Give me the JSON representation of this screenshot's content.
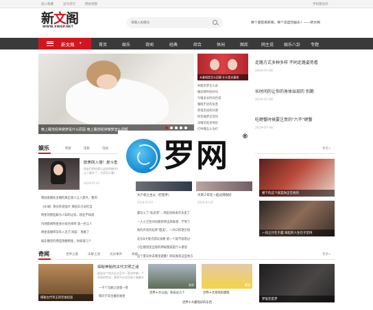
{
  "topbar": {
    "links": [
      "加入收藏",
      "设为首页",
      "网站地图"
    ],
    "right": "手机版访问"
  },
  "logo": {
    "main_a": "新",
    "main_b": "文",
    "main_c": "阁",
    "domain": "WWW.XWGP.NET"
  },
  "search": {
    "placeholder": "请输入关键词"
  },
  "slogan": "换个姿势看新闻，换个态度玩娱乐！——新文阁",
  "nav": {
    "home_label": "新文阁",
    "items": [
      "首页",
      "娱乐",
      "奇闻",
      "经典",
      "综合",
      "休闲",
      "图库",
      "网主说",
      "娱乐八卦",
      "专题"
    ]
  },
  "hero": {
    "caption": "晚上睡觉经常做梦是什么原因 晚上睡觉经常做梦怎么调理"
  },
  "side": {
    "photo_caption": "夫妻相是怎么回事 什么是夫妻相",
    "list": [
      "失眠多梦怎么办",
      "睡前喝牛奶好吗",
      "午睡多长时间合适",
      "睡眠不足的危害",
      "熬夜后如何补救",
      "经常做梦正常吗",
      "早睡早起身体好",
      "打呼噜怎么治疗"
    ]
  },
  "right_news": [
    {
      "title": "走路方式多种多样 不同走路姿势看",
      "date": "2019-07-06"
    },
    {
      "title": "长时间的让你的身体出现的 别跪",
      "date": "2019-07-06"
    },
    {
      "title": "吃螃蟹时候要注意的\"六不\"螃蟹",
      "date": "2019-07-06"
    }
  ],
  "ent": {
    "title": "娱乐",
    "tabs": [
      "明星",
      "电影",
      "电视"
    ],
    "more": "更多+",
    "head": "欧美网入侵！是斗鱼",
    "desc": "网友们纷纷表示这样的操作实在是太让人意外了，大家怎么看？",
    "date": "2019-07-07",
    "list": [
      "韩国直播女主播的真正收入让人意外，看到",
      "《长城》演员阵容强大 演技实力派担当",
      "明星的那些鲜为人知的过去，粉丝不知道",
      "内地影视明星身价排名榜单 第一名让人",
      "明星直播带货年入百万 网友：羡慕了",
      "娱乐圈里的那些隐婚明星，你知道几个"
    ]
  },
  "mid": {
    "cap1": "大户权之主以（打招手）",
    "date1": "2019-07-07",
    "cap2": "大英少年在一起过得很好",
    "date2": "2019-07-07",
    "list": [
      "最近火了\"仙女装\"，网友纷纷表示太美了",
      "一人小卫生间也能装修出高级感，学到了",
      "他的声音听起来\"甜美\"，一开口惊艳全场",
      "北京8大景点游玩攻略 第一个就不容错过",
      "小区楼道里出现的神秘图案是什么意思",
      "这个夏天你去哪里避暑？网友推荐这些地方"
    ]
  },
  "rimgs": [
    {
      "cap": "楼下的这个就是你正在找的"
    },
    {
      "cap": "一日之计在于晨 早起的人生在于坚持"
    }
  ],
  "watermark": {
    "text": "罗网",
    "reg": "®"
  },
  "strange": {
    "title": "奇闻",
    "tabs": [
      "世界之最",
      "未解之谜",
      "灵异事件",
      "奇趣"
    ],
    "more": "更多+",
    "thumb_caption": "揭秘古代帝王的饮食起居",
    "head": "探秘神秘的古代文明之谜",
    "desc": "据说这个地方从古至今一直流传着一个奇怪的传说，直到今天也没有人能解开",
    "list": [
      "一千个无解之谜第一卷",
      "揭开千年古墓的秘密"
    ],
    "captions": [
      "世界十大公园，你去过几个",
      "世界十大奇怪的建筑",
      "世界十大最怪异的东西"
    ],
    "tile_caps": [
      "女宫",
      "蘑菇",
      "梦里还是梦"
    ]
  },
  "colors": {
    "accent": "#d0171f",
    "nav": "#3a3a3a"
  }
}
